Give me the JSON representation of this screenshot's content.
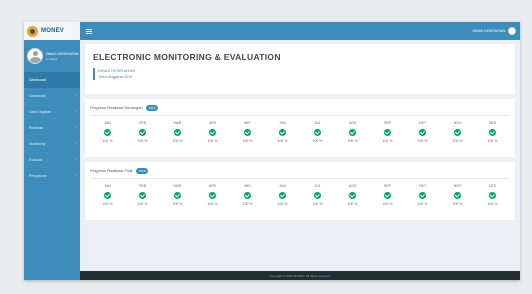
{
  "brand": {
    "name": "MONEV"
  },
  "user": {
    "name": "DINAS KESEHATAN",
    "status": "● Online"
  },
  "topbar": {
    "menu_label": "",
    "user_label": "DINAS KESEHATAN"
  },
  "sidebar": {
    "items": [
      {
        "label": "Dashboard",
        "active": true
      },
      {
        "label": "Dashboard",
        "active": false
      },
      {
        "label": "Data Kegiatan",
        "active": false
      },
      {
        "label": "Realisasi",
        "active": false
      },
      {
        "label": "Monitoring",
        "active": false
      },
      {
        "label": "Evaluasi",
        "active": false
      },
      {
        "label": "Pengaturan",
        "active": false
      }
    ]
  },
  "page": {
    "title": "ELECTRONIC MONITORING & EVALUATION",
    "project_name": "DINAS KESEHATAN",
    "project_sub": "Tahun Anggaran 2019"
  },
  "panels": [
    {
      "title": "Progress Realisasi Keuangan",
      "badge": "2019",
      "months": [
        "JAN",
        "FEB",
        "MAR",
        "APR",
        "MEI",
        "JUN",
        "JUL",
        "AGS",
        "SEP",
        "OKT",
        "NOV",
        "DES"
      ],
      "values": [
        "100 %",
        "100 %",
        "100 %",
        "100 %",
        "100 %",
        "100 %",
        "100 %",
        "100 %",
        "100 %",
        "100 %",
        "100 %",
        "100 %"
      ]
    },
    {
      "title": "Progress Realisasi Fisik",
      "badge": "2019",
      "months": [
        "JAN",
        "FEB",
        "MAR",
        "APR",
        "MEI",
        "JUN",
        "JUL",
        "AGS",
        "SEP",
        "OKT",
        "NOV",
        "DES"
      ],
      "values": [
        "100 %",
        "100 %",
        "100 %",
        "100 %",
        "100 %",
        "100 %",
        "100 %",
        "100 %",
        "100 %",
        "100 %",
        "100 %",
        "100 %"
      ]
    }
  ],
  "footer": {
    "text": "Copyright © 2019 MONEV. All rights reserved."
  }
}
